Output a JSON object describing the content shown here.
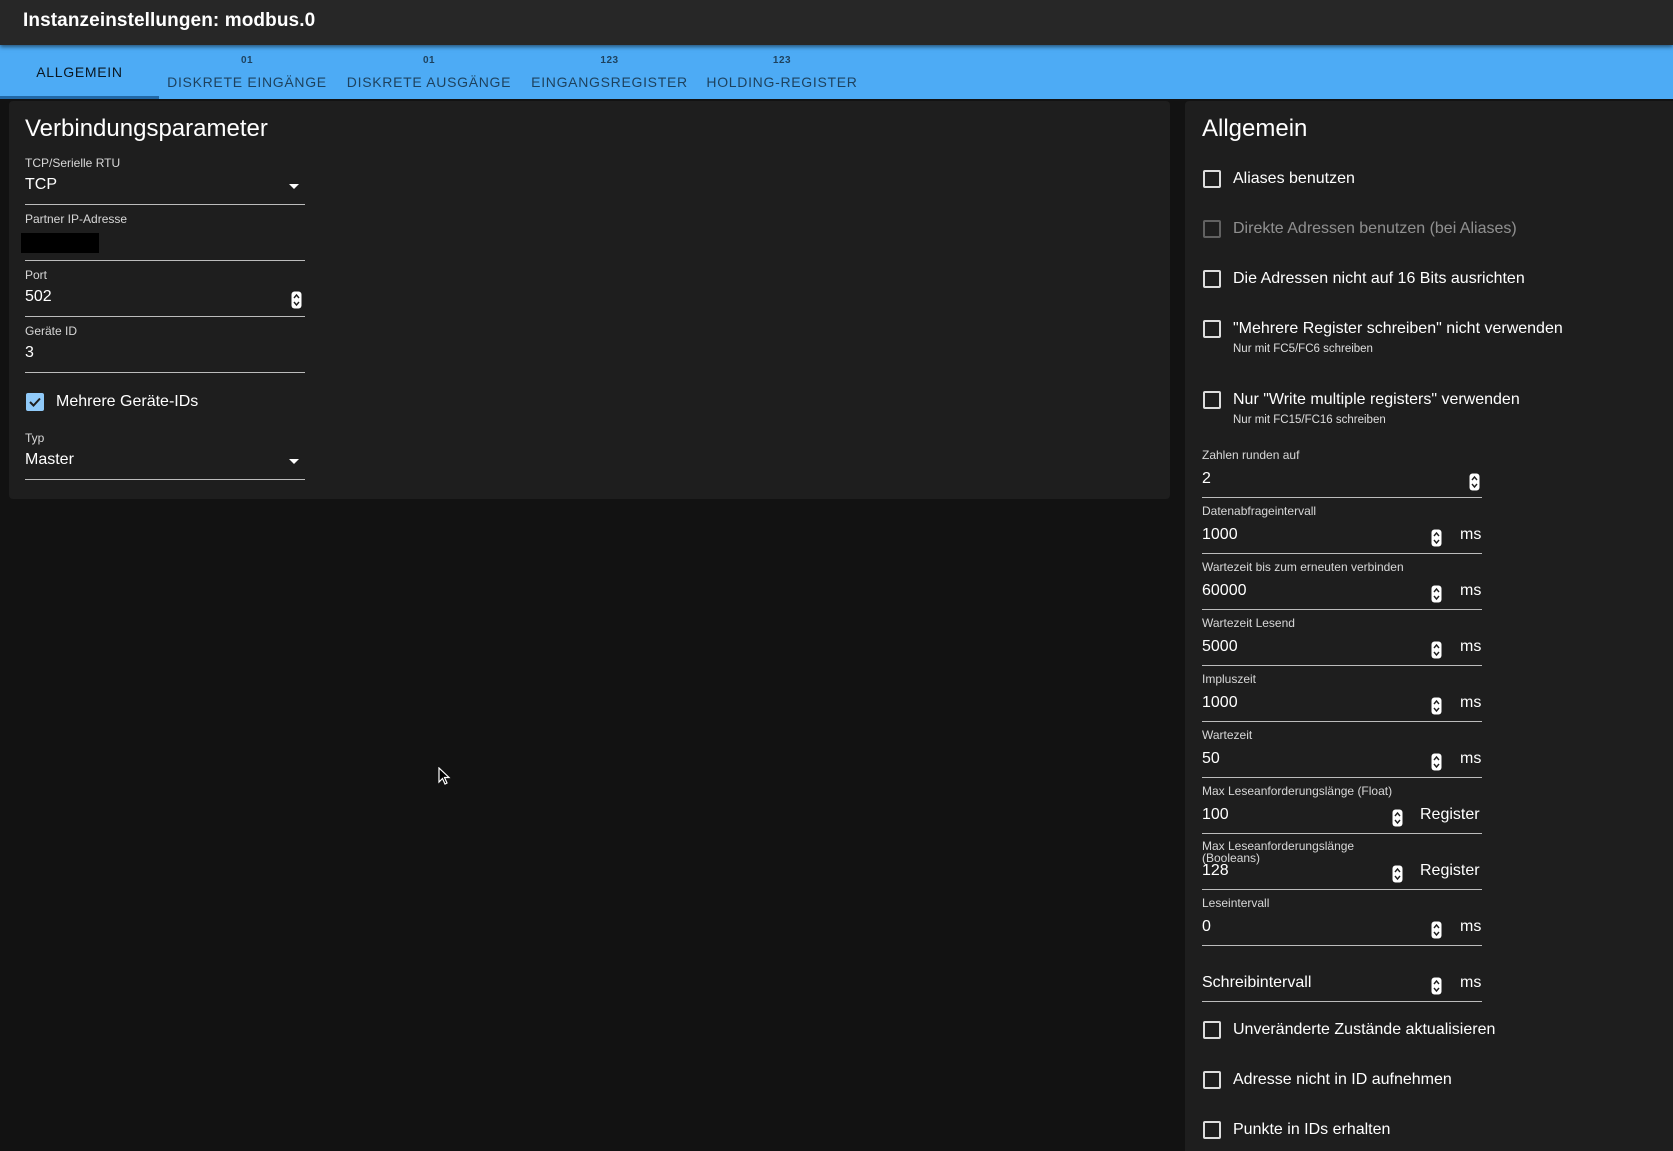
{
  "window": {
    "title": "Instanzeinstellungen: modbus.0"
  },
  "tabs": [
    {
      "icon": "",
      "label": "ALLGEMEIN"
    },
    {
      "icon": "01",
      "label": "DISKRETE EINGÄNGE"
    },
    {
      "icon": "01",
      "label": "DISKRETE AUSGÄNGE"
    },
    {
      "icon": "123",
      "label": "EINGANGSREGISTER"
    },
    {
      "icon": "123",
      "label": "HOLDING-REGISTER"
    }
  ],
  "connection": {
    "title": "Verbindungsparameter",
    "mode": {
      "label": "TCP/Serielle RTU",
      "value": "TCP"
    },
    "ip": {
      "label": "Partner IP-Adresse",
      "value": ""
    },
    "port": {
      "label": "Port",
      "value": "502"
    },
    "device_id": {
      "label": "Geräte ID",
      "value": "3"
    },
    "multi_ids": {
      "label": "Mehrere Geräte-IDs",
      "checked": true
    },
    "type": {
      "label": "Typ",
      "value": "Master"
    }
  },
  "general": {
    "title": "Allgemein",
    "checkboxes": [
      {
        "label": "Aliases benutzen",
        "checked": false,
        "disabled": false
      },
      {
        "label": "Direkte Adressen benutzen (bei Aliases)",
        "checked": false,
        "disabled": true
      },
      {
        "label": "Die Adressen nicht auf 16 Bits ausrichten",
        "checked": false,
        "disabled": false
      },
      {
        "label": "\"Mehrere Register schreiben\" nicht verwenden",
        "help": "Nur mit FC5/FC6 schreiben",
        "checked": false,
        "disabled": false
      },
      {
        "label": "Nur \"Write multiple registers\" verwenden",
        "help": "Nur mit FC15/FC16 schreiben",
        "checked": false,
        "disabled": false
      }
    ],
    "fields": [
      {
        "label": "Zahlen runden auf",
        "value": "2",
        "unit": ""
      },
      {
        "label": "Datenabfrageintervall",
        "value": "1000",
        "unit": "ms"
      },
      {
        "label": "Wartezeit bis zum erneuten verbinden",
        "value": "60000",
        "unit": "ms"
      },
      {
        "label": "Wartezeit Lesend",
        "value": "5000",
        "unit": "ms"
      },
      {
        "label": "Impluszeit",
        "value": "1000",
        "unit": "ms"
      },
      {
        "label": "Wartezeit",
        "value": "50",
        "unit": "ms"
      },
      {
        "label": "Max Leseanforderungslänge (Float)",
        "value": "100",
        "unit": "Register"
      },
      {
        "label": "Max Leseanforderungslänge (Booleans)",
        "value": "128",
        "unit": "Register"
      },
      {
        "label": "Leseintervall",
        "value": "0",
        "unit": "ms"
      },
      {
        "label": "",
        "value": "",
        "placeholder": "Schreibintervall",
        "unit": "ms"
      }
    ],
    "bottom_checkboxes": [
      {
        "label": "Unveränderte Zustände aktualisieren",
        "checked": false
      },
      {
        "label": "Adresse nicht in ID aufnehmen",
        "checked": false
      },
      {
        "label": "Punkte in IDs erhalten",
        "checked": false
      }
    ]
  },
  "colors": {
    "accent": "#4dabf5",
    "checkbox_checked": "#90caf9",
    "panel": "#1e1e1e",
    "background": "#121212"
  }
}
